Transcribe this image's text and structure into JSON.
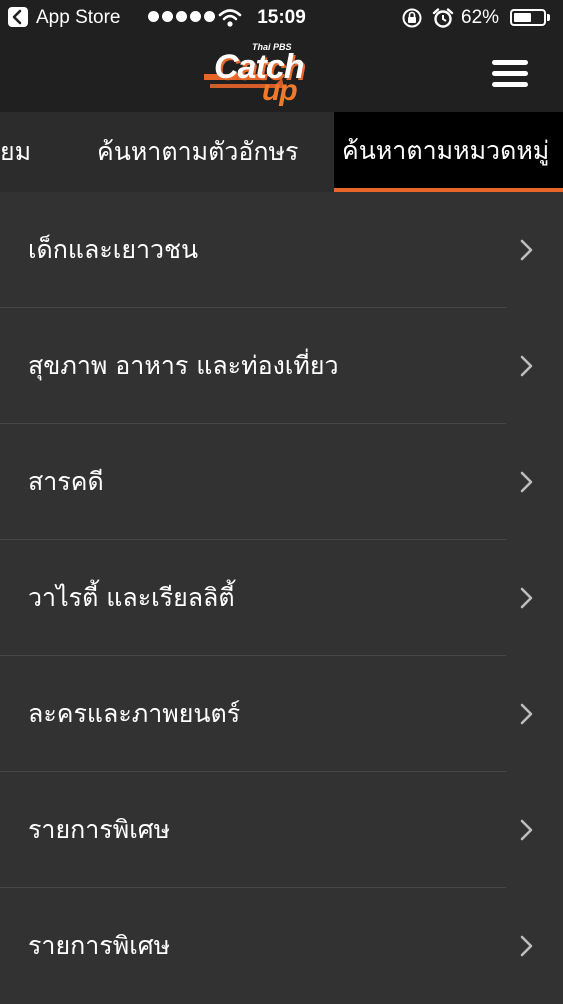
{
  "status_bar": {
    "carrier": "App Store",
    "time": "15:09",
    "battery_percent": "62%",
    "battery_level": 0.62
  },
  "header": {
    "logo_small": "Thai PBS",
    "logo_catch": "Catch",
    "logo_up": "up",
    "accent_color": "#e8652a"
  },
  "tabs": [
    {
      "label": "ยม"
    },
    {
      "label": "ค้นหาตามตัวอักษร"
    },
    {
      "label": "ค้นหาตามหมวดหมู่",
      "active": true
    }
  ],
  "categories": [
    {
      "label": "เด็กและเยาวชน"
    },
    {
      "label": "สุขภาพ อาหาร และท่องเที่ยว"
    },
    {
      "label": "สารคดี"
    },
    {
      "label": "วาไรตี้ และเรียลลิตี้"
    },
    {
      "label": "ละครและภาพยนตร์"
    },
    {
      "label": "รายการพิเศษ"
    },
    {
      "label": "รายการพิเศษ"
    }
  ],
  "icons": {
    "back": "back-chevron-icon",
    "wifi": "wifi-icon",
    "lock": "orientation-lock-icon",
    "alarm": "alarm-icon",
    "battery": "battery-icon",
    "menu": "hamburger-menu-icon",
    "row": "chevron-right-icon"
  }
}
